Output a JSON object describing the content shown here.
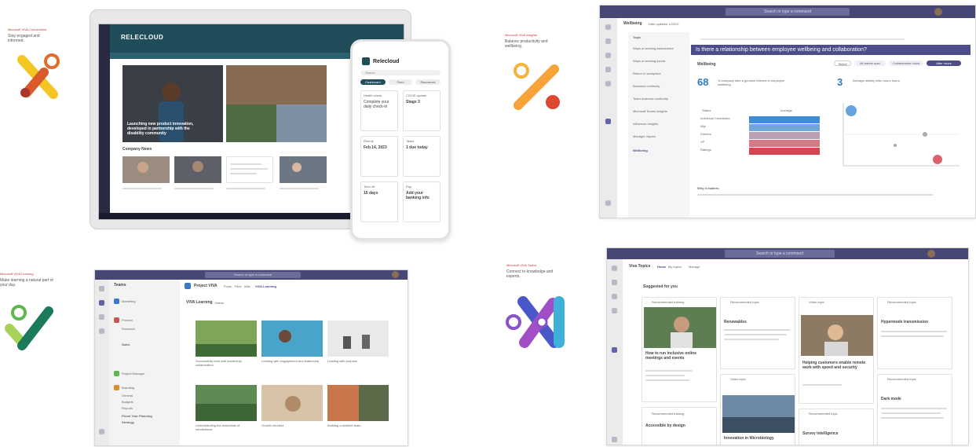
{
  "panels": {
    "informed": {
      "tag_head": "Microsoft VIVA Connections",
      "tag_body": "Stay engaged and informed."
    },
    "wellbeing": {
      "tag_head": "Microsoft VIVA Insights",
      "tag_body": "Balance productivity and wellbeing."
    },
    "learning": {
      "tag_head": "Microsoft VIVA Learning",
      "tag_body": "Make learning a natural part of your day."
    },
    "topics": {
      "tag_head": "Microsoft VIVA Topics",
      "tag_body": "Connect to knowledge and experts."
    }
  },
  "connections": {
    "brand": "RELECLOUD",
    "feature_caption": "Launching new product innovation, developed in partnership with the disability community",
    "section_label": "Company News",
    "phone": {
      "brand": "Relecloud",
      "search": "Search",
      "tabs": [
        "Dashboard",
        "Feed",
        "Resources"
      ],
      "cards": [
        {
          "title": "Health check",
          "body": "Complete your daily check-in"
        },
        {
          "title": "COVID update",
          "body": "Stage 3"
        },
        {
          "title": "Recruit",
          "body": "Feb 14, 2023"
        },
        {
          "title": "Tasks",
          "body": "1 due today"
        },
        {
          "title": "Time off",
          "body": "15 days"
        },
        {
          "title": "Pay",
          "body": "Add your banking info"
        }
      ]
    }
  },
  "insights": {
    "search": "Search or type a command",
    "tab_title": "Wellbeing",
    "tab_date": "Date updated 1/20/22",
    "nav_title": "Topic",
    "nav_items": [
      "Ways of working assessment",
      "Ways of working trends",
      "Return to workplace",
      "Business continuity",
      "Team business continuity",
      "Microsoft Teams insights",
      "Influencer insights",
      "Manager impact",
      "Wellbeing"
    ],
    "question": "Is there a relationship between employee wellbeing and collaboration?",
    "left_title": "Wellbeing",
    "left_stat": "68",
    "left_stat_text": "% company take a genuine interest in employee wellbeing",
    "right_stat": "3",
    "right_stat_text": "Average weekly after-hours hours",
    "filters": [
      "Select",
      "All-hands sync",
      "Collaboration hours",
      "After hours"
    ],
    "table_headers": [
      "Status",
      "Average"
    ],
    "table_rows": [
      "Individual Contributor",
      "Mgr",
      "Director",
      "VP",
      "Ratings"
    ],
    "heatmap_colors": [
      "#3e8ed6",
      "#6fa5d8",
      "#b9a0b4",
      "#d47a85",
      "#d64552"
    ],
    "why_title": "Why it matters"
  },
  "learning": {
    "search": "Search or type a command",
    "rail_title": "Teams",
    "team_title": "Project VIVA",
    "tabs": [
      "Posts",
      "Files",
      "Wiki",
      "VIVA Learning"
    ],
    "subtitle": "VIVA Learning",
    "subtitle_sub": "Videos",
    "items": [
      "Teams",
      "Marketing",
      "Product",
      "Research",
      "Sales",
      "Project Manager",
      "Branding",
      "General",
      "Budgets",
      "Reports",
      "Fiscal Year Planning",
      "Strategy"
    ],
    "thumb_captions": [
      "Successfully lead with leadership collaboration",
      "Leading with engagement and leadership",
      "Leading with purpose",
      "Understanding the essentials of mindfulness",
      "Growth mindset",
      "Building a resilient team"
    ]
  },
  "topics": {
    "search": "Search or type a command",
    "tab_title": "Viva Topics",
    "tabs": [
      "Home",
      "My topics",
      "Manage"
    ],
    "suggested": "Suggested for you",
    "cards": [
      {
        "kind": "Recommended training",
        "title": "How to run inclusive online meetings and events"
      },
      {
        "kind": "Recommended topic",
        "title": "Renewables"
      },
      {
        "kind": "Video topic",
        "title": "Helping customers enable remote work with speed and security"
      },
      {
        "kind": "Recommended topic",
        "title": "Hypermode transmission"
      },
      {
        "kind": "Recommended topic",
        "title": "Dark mode"
      },
      {
        "kind": "Recommended training",
        "title": "Accessible by design"
      },
      {
        "kind": "Video topic",
        "title": "Innovation in Microbiology"
      },
      {
        "kind": "Recommended topic",
        "title": "Survey intelligence"
      }
    ]
  }
}
